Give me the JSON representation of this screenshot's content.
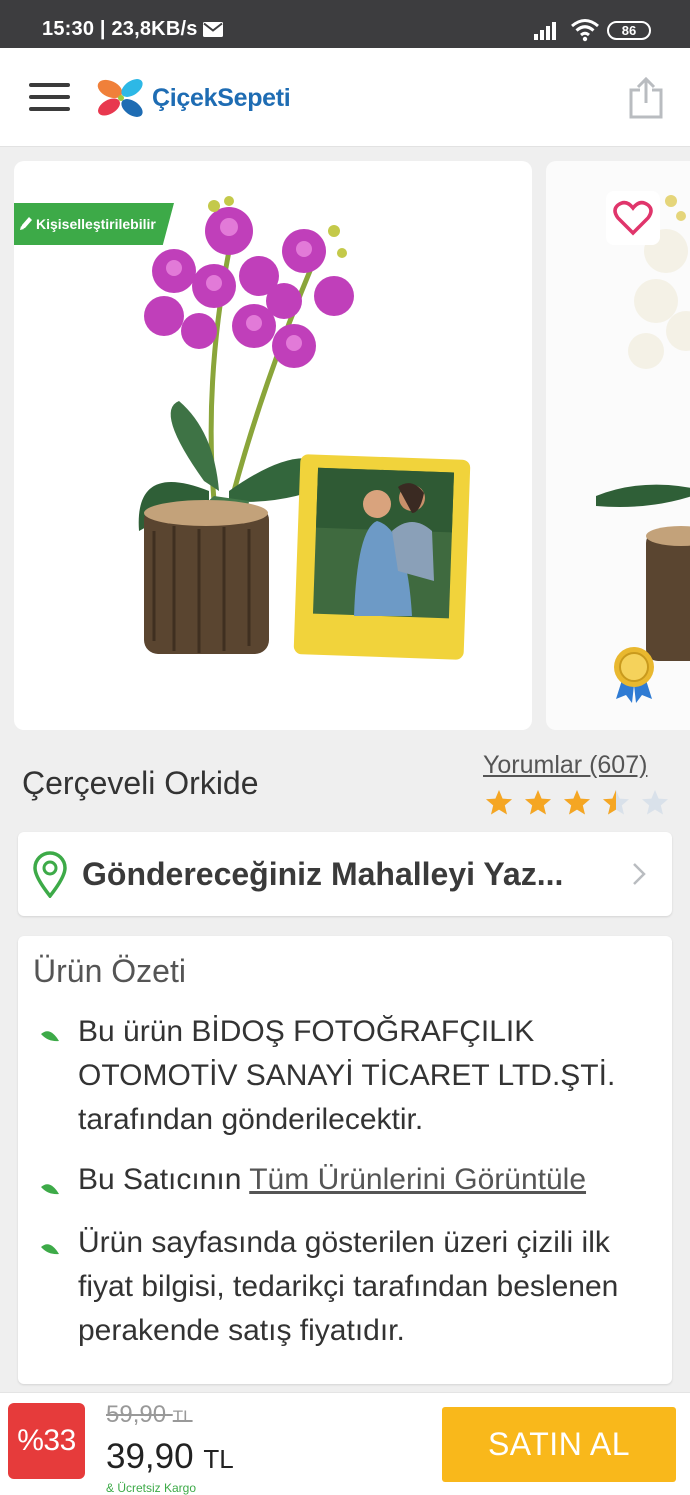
{
  "status_bar": {
    "time": "15:30 | 23,8KB/s",
    "battery": "86"
  },
  "header": {
    "logo_text": "ÇiçekSepeti"
  },
  "product": {
    "badge": "Kişiselleştirilebilir",
    "title": "Çerçeveli Orkide",
    "reviews_label": "Yorumlar (607)",
    "rating": 3.5,
    "rating_max": 5
  },
  "location": {
    "placeholder": "Göndereceğiniz Mahalleyi Yaz..."
  },
  "summary": {
    "title": "Ürün Özeti",
    "item1": "Bu ürün BİDOŞ FOTOĞRAFÇILIK OTOMOTİV SANAYİ TİCARET LTD.ŞTİ. tarafından gönderilecektir.",
    "item2_prefix": "Bu Satıcının",
    "item2_link": "Tüm Ürünlerini Görüntüle",
    "item3": "Ürün sayfasında gösterilen üzeri çizili ilk fiyat bilgisi, tedarikçi tarafından beslenen perakende satış fiyatıdır."
  },
  "purchase": {
    "discount": "%33",
    "old_price": "59,90",
    "old_currency": "TL",
    "new_price": "39,90",
    "new_currency": "TL",
    "shipping": "& Ücretsiz Kargo",
    "buy_label": "SATIN AL"
  },
  "colors": {
    "accent_green": "#3daa48",
    "buy_orange": "#f9b81b",
    "discount_red": "#e63b3b",
    "brand_blue": "#1e6cb3",
    "heart_pink": "#e0356b"
  }
}
